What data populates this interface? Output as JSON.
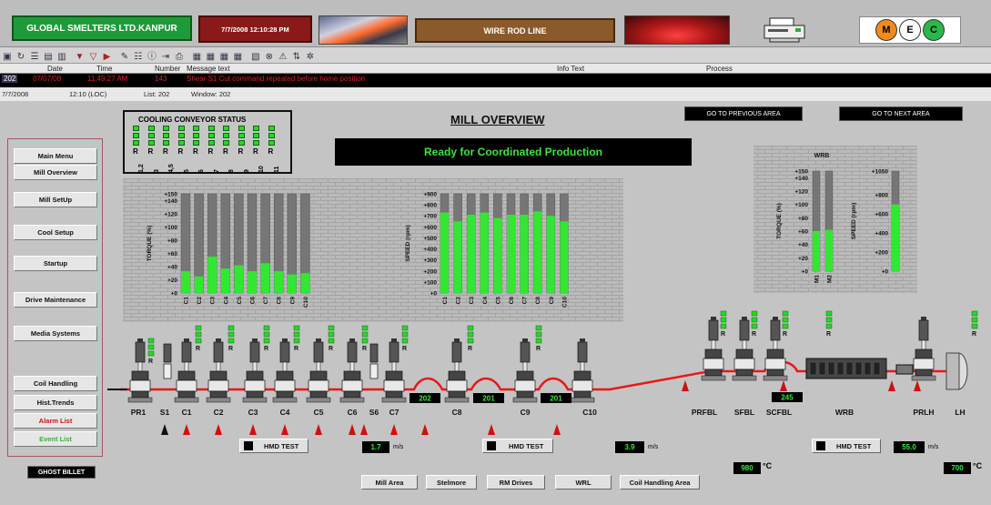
{
  "header": {
    "company": "GLOBAL SMELTERS LTD.KANPUR",
    "datetime": "7/7/2008 12:10:28 PM",
    "line_name": "WIRE ROD LINE",
    "logo_letters": [
      "M",
      "E",
      "C"
    ]
  },
  "alarm_table": {
    "columns": {
      "date": "Date",
      "time": "Time",
      "number": "Number",
      "message": "Message text",
      "info": "Info Text",
      "process": "Process"
    },
    "row": {
      "id": "202",
      "date": "07/07/08",
      "time": "11:49:27 AM",
      "number": "143",
      "message": "Shear S1 Cut command repeated before home position"
    },
    "status": {
      "date": "7/7/2008",
      "time": "12:10 (LOC)",
      "list": "List: 202",
      "window": "Window: 202"
    }
  },
  "title": "MILL OVERVIEW",
  "status_banner": "Ready for Coordinated Production",
  "nav_area": {
    "prev": "GO TO PREVIOUS AREA",
    "next": "GO TO NEXT AREA"
  },
  "nav_menu": [
    {
      "label": "Main Menu",
      "color": "#111111"
    },
    {
      "label": "Mill Overview",
      "color": "#111111"
    },
    {
      "label": "Mill SetUp",
      "color": "#111111"
    },
    {
      "label": "Cool Setup",
      "color": "#111111"
    },
    {
      "label": "Startup",
      "color": "#111111"
    },
    {
      "label": "Drive Maintenance",
      "color": "#111111"
    },
    {
      "label": "Media Systems",
      "color": "#111111"
    },
    {
      "label": "Coil Handling",
      "color": "#111111"
    },
    {
      "label": "Hist.Trends",
      "color": "#111111"
    },
    {
      "label": "Alarm List",
      "color": "#d01010"
    },
    {
      "label": "Event List",
      "color": "#2cb82c"
    }
  ],
  "cooling_conveyor": {
    "title": "COOLING CONVEYOR STATUS",
    "labels": [
      "1,2",
      "3",
      "4,5",
      "5",
      "6",
      "7",
      "8",
      "9",
      "10",
      "11"
    ],
    "state": "R"
  },
  "chart_data": [
    {
      "type": "bar",
      "ylabel": "TORQUE (%)",
      "categories": [
        "C1",
        "C2",
        "C3",
        "C4",
        "C5",
        "C6",
        "C7",
        "C8",
        "C9",
        "C10"
      ],
      "values": [
        33,
        25,
        55,
        37,
        42,
        33,
        45,
        33,
        28,
        30
      ],
      "ylim": [
        0,
        150
      ],
      "yticks": [
        "+0",
        "+20",
        "+40",
        "+60",
        "+80",
        "+100",
        "+120",
        "+140",
        "+150"
      ]
    },
    {
      "type": "bar",
      "ylabel": "SPEED (rpm)",
      "categories": [
        "C1",
        "C2",
        "C3",
        "C4",
        "C5",
        "C6",
        "C7",
        "C8",
        "C9",
        "C10"
      ],
      "values": [
        730,
        650,
        710,
        730,
        680,
        710,
        710,
        740,
        700,
        650
      ],
      "ylim": [
        0,
        900
      ],
      "yticks": [
        "+0",
        "+100",
        "+200",
        "+300",
        "+400",
        "+500",
        "+600",
        "+700",
        "+800",
        "+900"
      ]
    },
    {
      "type": "bar",
      "title": "WRB",
      "ylabel": "TORQUE (%)",
      "categories": [
        "M1",
        "M2"
      ],
      "values": [
        60,
        62
      ],
      "ylim": [
        0,
        150
      ],
      "yticks": [
        "+0",
        "+20",
        "+40",
        "+60",
        "+80",
        "+100",
        "+120",
        "+140",
        "+150"
      ]
    },
    {
      "type": "bar",
      "ylabel": "SPEED (rpm)",
      "categories": [
        ""
      ],
      "values": [
        700
      ],
      "ylim": [
        0,
        1050
      ],
      "yticks": [
        "+0",
        "+200",
        "+400",
        "+600",
        "+800",
        "+1050"
      ]
    }
  ],
  "mill_stands": {
    "labels": [
      "PR1",
      "S1",
      "C1",
      "C2",
      "C3",
      "C4",
      "C5",
      "C6",
      "S6",
      "C7",
      "C8",
      "C9",
      "C10",
      "PRFBL",
      "SFBL",
      "SCFBL",
      "WRB",
      "PRLH",
      "LH"
    ],
    "loop_values": [
      "202",
      "201",
      "201",
      "245"
    ]
  },
  "readouts": {
    "hmd_test": "HMD TEST",
    "speed1": "1.7",
    "speed2": "3.9",
    "speed3": "55.0",
    "speed_unit": "m/s",
    "temp1": "980",
    "temp2": "700",
    "temp_unit": "°C"
  },
  "ghost_billet": "GHOST BILLET",
  "bottom_nav": [
    "Mill Area",
    "Stelmore",
    "RM Drives",
    "WRL",
    "Coil Handling Area"
  ]
}
